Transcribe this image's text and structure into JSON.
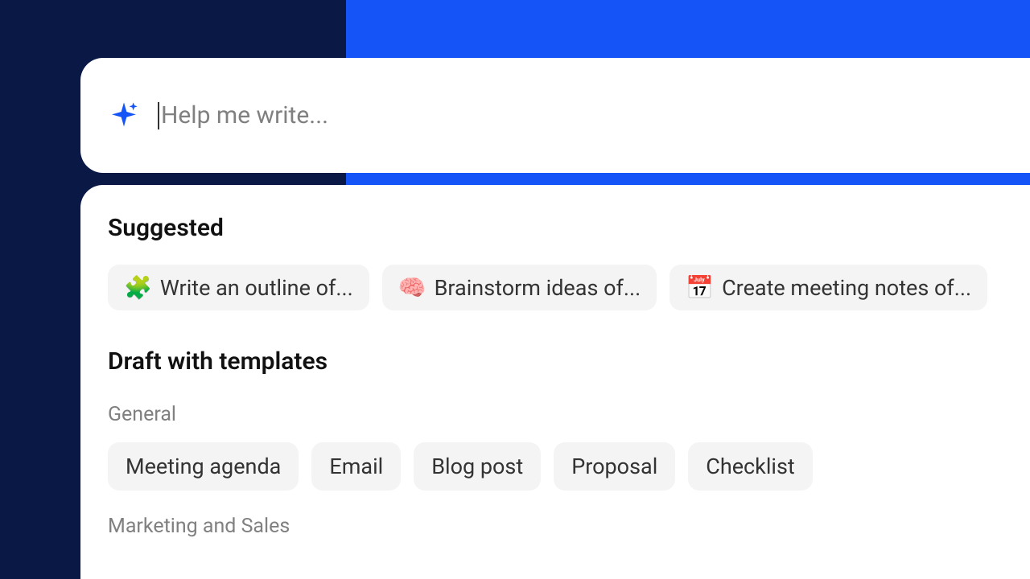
{
  "input": {
    "placeholder": "Help me write..."
  },
  "suggested": {
    "title": "Suggested",
    "items": [
      {
        "emoji": "🧩",
        "label": "Write an outline of..."
      },
      {
        "emoji": "🧠",
        "label": "Brainstorm ideas of..."
      },
      {
        "emoji": "📅",
        "label": "Create meeting notes of..."
      }
    ]
  },
  "templates": {
    "title": "Draft with templates",
    "groups": [
      {
        "label": "General",
        "items": [
          "Meeting agenda",
          "Email",
          "Blog post",
          "Proposal",
          "Checklist"
        ]
      },
      {
        "label": "Marketing and Sales",
        "items": []
      }
    ]
  }
}
